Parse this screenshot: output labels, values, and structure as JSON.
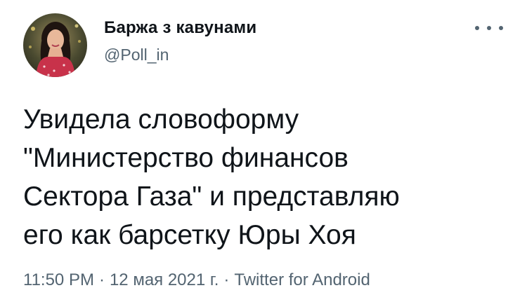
{
  "author": {
    "display_name": "Баржа з кавунами",
    "handle": "@Poll_in",
    "avatar": "profile-photo"
  },
  "more_icon": "ellipsis-icon",
  "tweet": {
    "lines": [
      "Увидела словоформу",
      "\"Министерство финансов",
      "Сектора Газа\" и представляю",
      "его как барсетку Юры Хоя"
    ]
  },
  "meta": {
    "time": "11:50 PM",
    "separator": "·",
    "date": "12 мая 2021 г.",
    "source": "Twitter for Android"
  },
  "colors": {
    "text": "#0f1419",
    "secondary": "#536471",
    "background": "#ffffff"
  }
}
